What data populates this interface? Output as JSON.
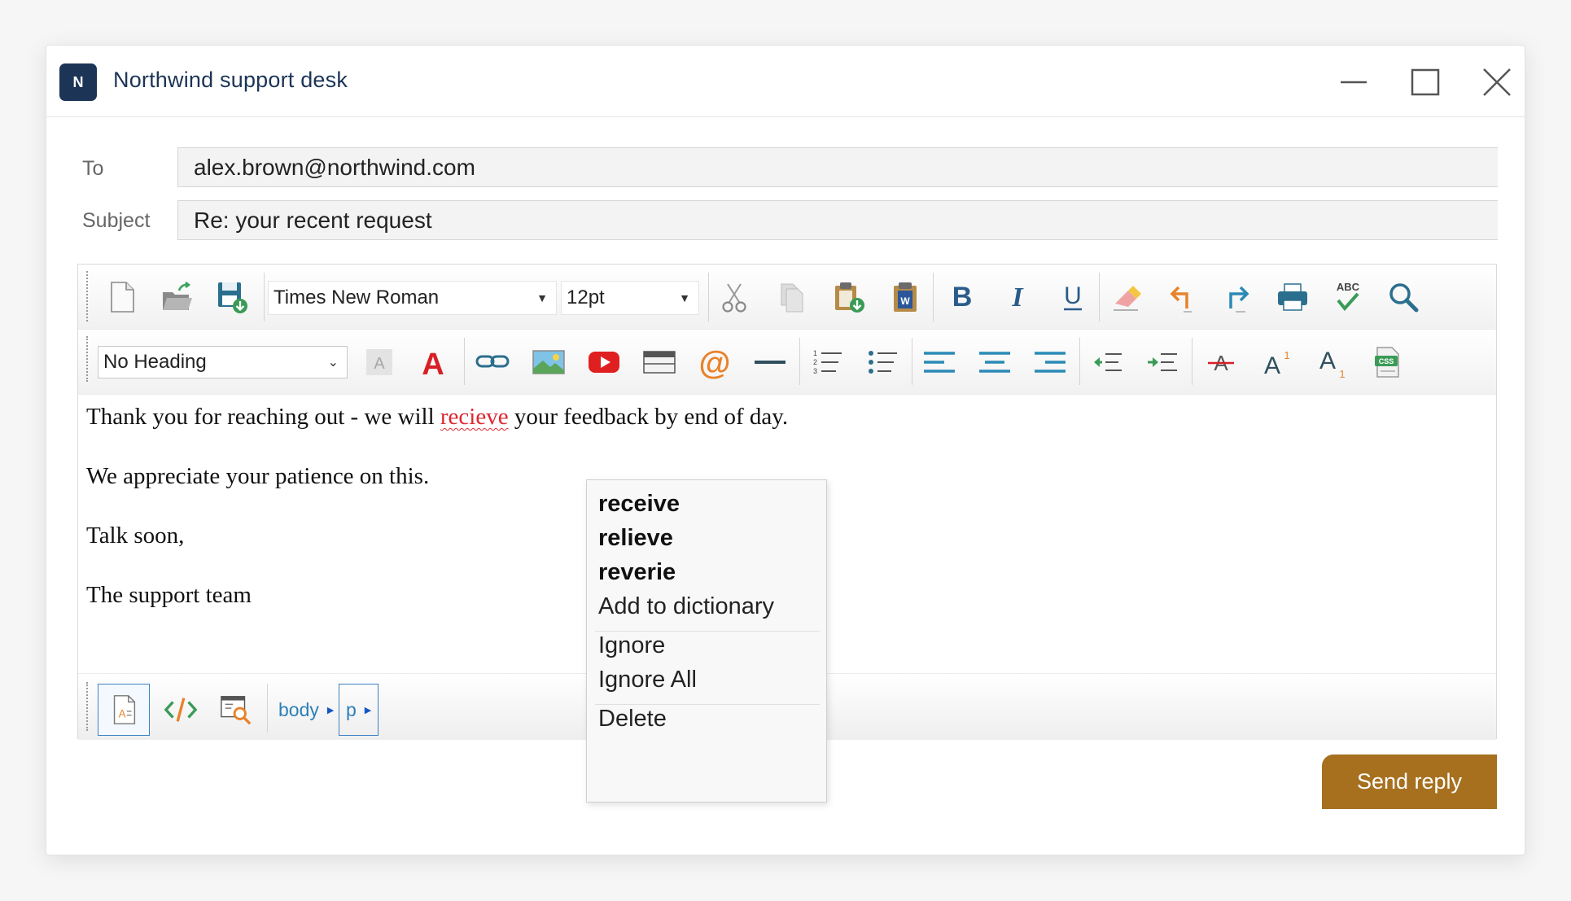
{
  "app": {
    "badge_letter": "N",
    "title": "Northwind support desk"
  },
  "fields": {
    "to_label": "To",
    "to_value": "alex.brown@northwind.com",
    "subject_label": "Subject",
    "subject_value": "Re: your recent request"
  },
  "toolbar": {
    "font_family": "Times New Roman",
    "font_size": "12pt",
    "heading": "No Heading",
    "colors": {
      "bold_blue": "#2a5b8a",
      "accent_red": "#d81f26",
      "accent_orange": "#e8822a",
      "accent_teal": "#2b8ab6"
    }
  },
  "body": {
    "line1_before": "Thank you for reaching out - we will ",
    "line1_misspelled": "recieve",
    "line1_after": " your feedback by end of day.",
    "line2": "We appreciate your patience on this.",
    "line3": "Talk soon,",
    "line4": "The support team"
  },
  "breadcrumbs": [
    "body",
    "p"
  ],
  "context_menu": {
    "suggestions": [
      "receive",
      "relieve",
      "reverie"
    ],
    "add_to_dictionary": "Add to dictionary",
    "ignore": "Ignore",
    "ignore_all": "Ignore All",
    "delete": "Delete"
  },
  "send_label": "Send reply",
  "theme": {
    "brand_navy": "#1c3556",
    "send_button": "#a6701f",
    "spell_error": "#e0262f"
  }
}
